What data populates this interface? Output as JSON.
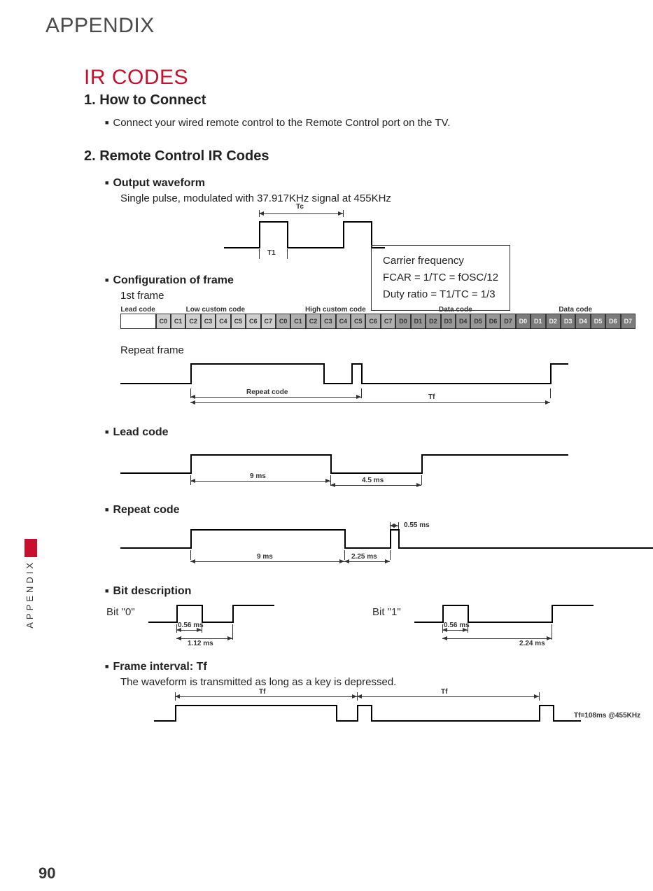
{
  "header": {
    "title": "APPENDIX"
  },
  "ir_title": "IR CODES",
  "sec1": {
    "heading": "1. How to Connect",
    "bullet": "Connect your wired remote control to the Remote Control port on the TV."
  },
  "sec2": {
    "heading": "2. Remote Control IR Codes",
    "output_waveform": {
      "title": "Output waveform",
      "desc": "Single pulse, modulated with 37.917KHz signal at 455KHz",
      "labels": {
        "tc": "Tc",
        "t1": "T1"
      }
    },
    "carrier": {
      "l1": "Carrier frequency",
      "l2": "FCAR = 1/TC = fOSC/12",
      "l3": "Duty ratio = T1/TC = 1/3"
    },
    "config_frame": {
      "title": "Configuration of frame",
      "first": "1st frame",
      "labels": {
        "lead": "Lead code",
        "low": "Low custom code",
        "high": "High custom code",
        "data1": "Data code",
        "data2": "Data code"
      },
      "low_cells": [
        "C0",
        "C1",
        "C2",
        "C3",
        "C4",
        "C5",
        "C6",
        "C7"
      ],
      "high_cells": [
        "C0",
        "C1",
        "C2",
        "C3",
        "C4",
        "C5",
        "C6",
        "C7"
      ],
      "data1_cells": [
        "D0",
        "D1",
        "D2",
        "D3",
        "D4",
        "D5",
        "D6",
        "D7"
      ],
      "data2_cells": [
        "D0",
        "D1",
        "D2",
        "D3",
        "D4",
        "D5",
        "D6",
        "D7"
      ],
      "repeat": "Repeat frame",
      "repeat_labels": {
        "repeat_code": "Repeat  code",
        "tf": "Tf"
      }
    },
    "lead_code": {
      "title": "Lead code",
      "t_high": "9 ms",
      "t_low": "4.5 ms"
    },
    "repeat_code": {
      "title": "Repeat code",
      "t_high": "9 ms",
      "t_gap": "2.25 ms",
      "t_pulse": "0.55 ms"
    },
    "bit_desc": {
      "title": "Bit description",
      "bit0": "Bit \"0\"",
      "bit1": "Bit \"1\"",
      "pulse": "0.56 ms",
      "bit0_total": "1.12 ms",
      "bit1_total": "2.24 ms"
    },
    "frame_interval": {
      "title": "Frame interval: Tf",
      "desc": "The waveform is transmitted as long as a key is depressed.",
      "tf": "Tf",
      "note": "Tf=108ms @455KHz"
    }
  },
  "side_tab": "APPENDIX",
  "page_number": "90"
}
